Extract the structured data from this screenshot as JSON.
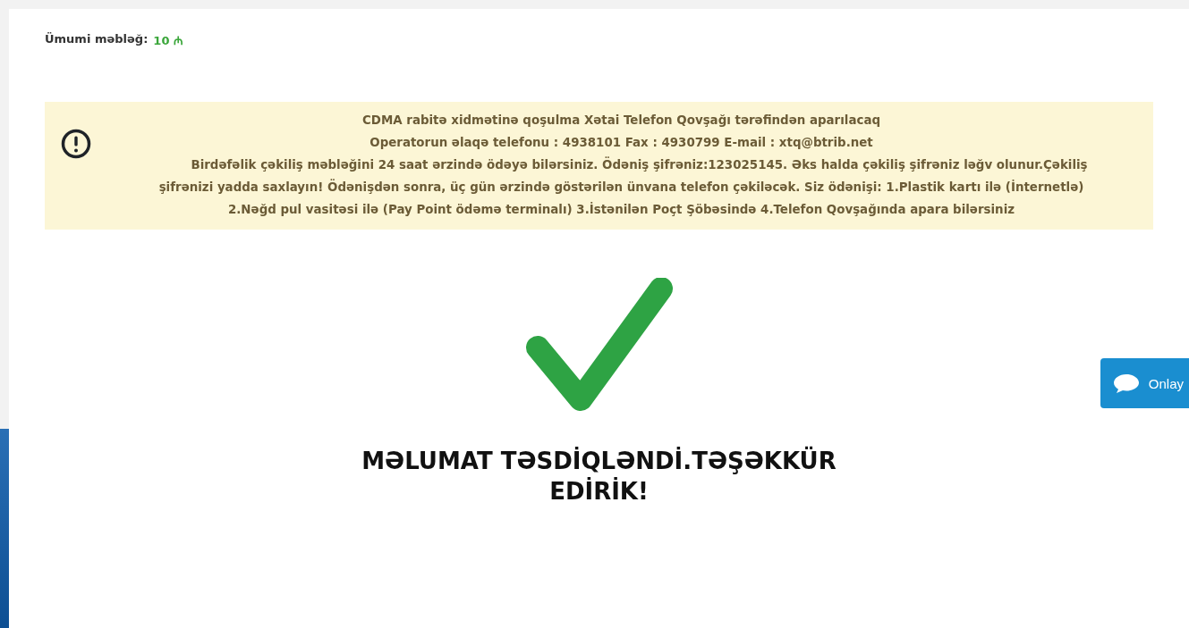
{
  "total": {
    "label": "Ümumi məbləğ:",
    "amount": "10",
    "currency": "₼"
  },
  "notice": {
    "lines": [
      "CDMA rabitə xidmətinə qoşulma Xətai Telefon Qovşağı tərəfindən aparılacaq",
      "Operatorun əlaqə telefonu : 4938101 Fax : 4930799 E-mail : xtq@btrib.net"
    ],
    "paragraph": "Birdəfəlik çəkiliş məbləğini 24 saat ərzində ödəyə bilərsiniz. Ödəniş şifrəniz:123025145. Əks halda çəkiliş şifrəniz ləğv olunur.Çəkiliş şifrənizi yadda saxlayın! Ödənişdən sonra, üç gün ərzində göstərilən ünvana telefon çəkiləcək. Siz ödənişi: 1.Plastik kartı ilə (İnternetlə) 2.Nəğd pul vasitəsi ilə (Pay Point ödəmə terminalı) 3.İstənilən Poçt Şöbəsində 4.Telefon Qovşağında apara bilərsiniz"
  },
  "confirmation": "MƏLUMAT TƏSDİQLƏNDİ.TƏŞƏKKÜR EDİRİK!",
  "chat_button": "Onlay"
}
